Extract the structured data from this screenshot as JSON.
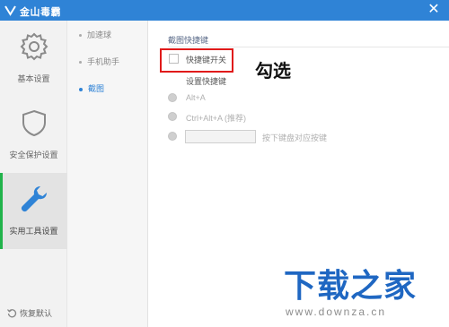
{
  "window": {
    "title": "金山毒霸",
    "close_glyph": "✕"
  },
  "left_nav": {
    "items": [
      {
        "label": "基本设置",
        "icon": "gear-icon"
      },
      {
        "label": "安全保护设置",
        "icon": "shield-icon"
      },
      {
        "label": "实用工具设置",
        "icon": "wrench-icon",
        "active": true
      }
    ],
    "restore_label": "恢复默认"
  },
  "sub_nav": {
    "items": [
      {
        "label": "加速球"
      },
      {
        "label": "手机助手"
      },
      {
        "label": "截图",
        "active": true
      }
    ]
  },
  "main": {
    "section_title": "截图快捷键",
    "toggle_label": "快捷键开关",
    "toggle_checked": false,
    "sub_title": "设置快捷键",
    "options": [
      {
        "label": "Alt+A"
      },
      {
        "label": "Ctrl+Alt+A (推荐)"
      },
      {
        "label": "按下键盘对应按键"
      }
    ],
    "hotkey_value": ""
  },
  "annotation": "勾选",
  "watermark": {
    "main": "下载之家",
    "url": "www.downza.cn"
  },
  "colors": {
    "titlebar": "#2f83d6",
    "accent": "#2f83d6",
    "active_bar": "#21b34b",
    "highlight_border": "#e01a1a",
    "watermark": "#1f67c2"
  }
}
